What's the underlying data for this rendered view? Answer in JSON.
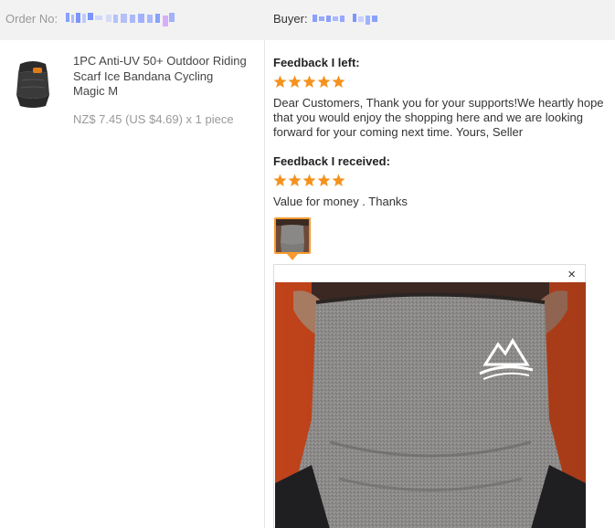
{
  "header": {
    "order_label": "Order No:",
    "buyer_label": "Buyer:"
  },
  "product": {
    "image_icon": "neck-gaiter-product-icon",
    "title": "1PC Anti-UV 50+ Outdoor Riding Scarf Ice Bandana Cycling Magic M",
    "price": "NZ$ 7.45 (US $4.69) x 1 piece"
  },
  "feedback_left": {
    "heading": "Feedback I left:",
    "rating": 5,
    "text": "Dear Customers, Thank you for your supports!We heartly hope that you would enjoy the shopping here and we are looking forward for your coming next time. Yours, Seller"
  },
  "feedback_received": {
    "heading": "Feedback I received:",
    "rating": 5,
    "text": "Value for money . Thanks"
  },
  "photo_preview": {
    "close_label": "×",
    "thumb_icon": "buyer-photo-thumbnail",
    "image_icon": "buyer-photo-large"
  },
  "colors": {
    "header_bg": "#f2f2f2",
    "star": "#f5921e",
    "thumb_border": "#f79a2f"
  }
}
